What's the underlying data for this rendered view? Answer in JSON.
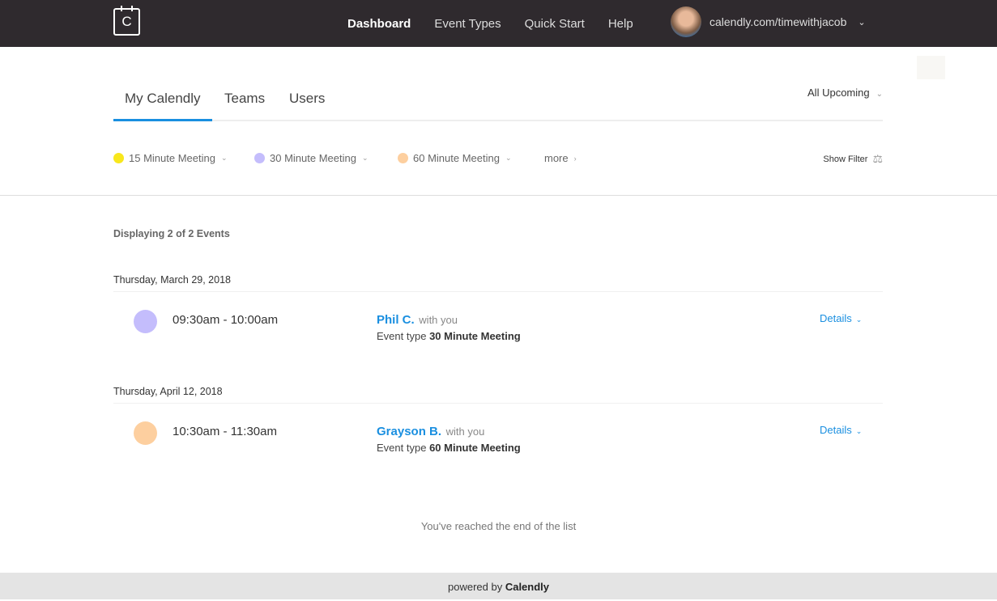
{
  "topbar": {
    "logo_letter": "C",
    "nav": [
      "Dashboard",
      "Event Types",
      "Quick Start",
      "Help"
    ],
    "user_url": "calendly.com/timewithjacob"
  },
  "tabs": [
    "My Calendly",
    "Teams",
    "Users"
  ],
  "range_select": "All Upcoming",
  "filters": [
    {
      "label": "15 Minute Meeting",
      "color": "#f8e71c"
    },
    {
      "label": "30 Minute Meeting",
      "color": "#c4bdfc"
    },
    {
      "label": "60 Minute Meeting",
      "color": "#fdcf9f"
    }
  ],
  "more_label": "more",
  "show_filter": "Show Filter",
  "count_text": "Displaying 2 of 2 Events",
  "events": [
    {
      "date": "Thursday, March 29, 2018",
      "time": "09:30am - 10:00am",
      "name": "Phil C.",
      "with": "with you",
      "type_label": "Event type",
      "type": "30 Minute Meeting",
      "details": "Details",
      "color": "#c4bdfc"
    },
    {
      "date": "Thursday, April 12, 2018",
      "time": "10:30am - 11:30am",
      "name": "Grayson B.",
      "with": "with you",
      "type_label": "Event type",
      "type": "60 Minute Meeting",
      "details": "Details",
      "color": "#fdcf9f"
    }
  ],
  "end_text": "You've reached the end of the list",
  "footer": {
    "prefix": "powered by",
    "brand": "Calendly"
  }
}
